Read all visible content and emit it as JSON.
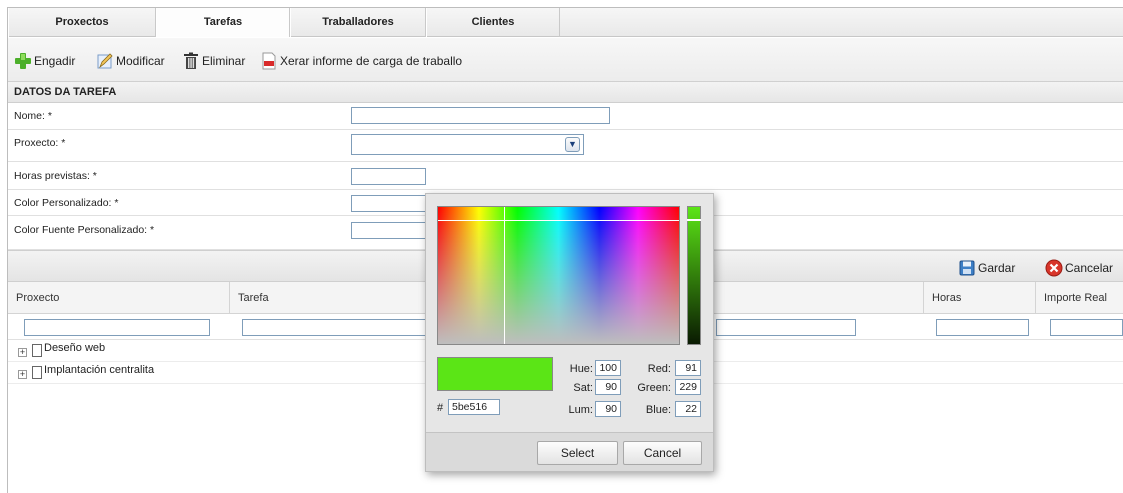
{
  "tabs": [
    {
      "label": "Proxectos"
    },
    {
      "label": "Tarefas",
      "active": true
    },
    {
      "label": "Traballadores"
    },
    {
      "label": "Clientes"
    }
  ],
  "toolbar": {
    "add": "Engadir",
    "edit": "Modificar",
    "delete": "Eliminar",
    "report": "Xerar informe de carga de traballo"
  },
  "form": {
    "section_title": "DATOS DA TAREFA",
    "name_label": "Nome: *",
    "project_label": "Proxecto: *",
    "hours_label": "Horas previstas: *",
    "color_label": "Color Personalizado: *",
    "font_color_label": "Color Fuente Personalizado: *"
  },
  "actions": {
    "save": "Gardar",
    "cancel": "Cancelar"
  },
  "grid": {
    "columns": [
      "Proxecto",
      "Tarefa",
      "Horas",
      "Importe Real"
    ],
    "rows": [
      "Deseño web",
      "Implantación centralita"
    ]
  },
  "color_picker": {
    "hex_prefix": "#",
    "hex": "5be516",
    "hue_label": "Hue:",
    "hue": "100",
    "sat_label": "Sat:",
    "sat": "90",
    "lum_label": "Lum:",
    "lum": "90",
    "red_label": "Red:",
    "red": "91",
    "green_label": "Green:",
    "green": "229",
    "blue_label": "Blue:",
    "blue": "22",
    "select_label": "Select",
    "cancel_label": "Cancel",
    "preview_color": "#5be516"
  },
  "icons": {
    "add": "plus-icon",
    "edit": "pencil-icon",
    "delete": "trash-icon",
    "report": "pdf-icon",
    "save": "floppy-icon",
    "cancel": "cancel-icon"
  }
}
